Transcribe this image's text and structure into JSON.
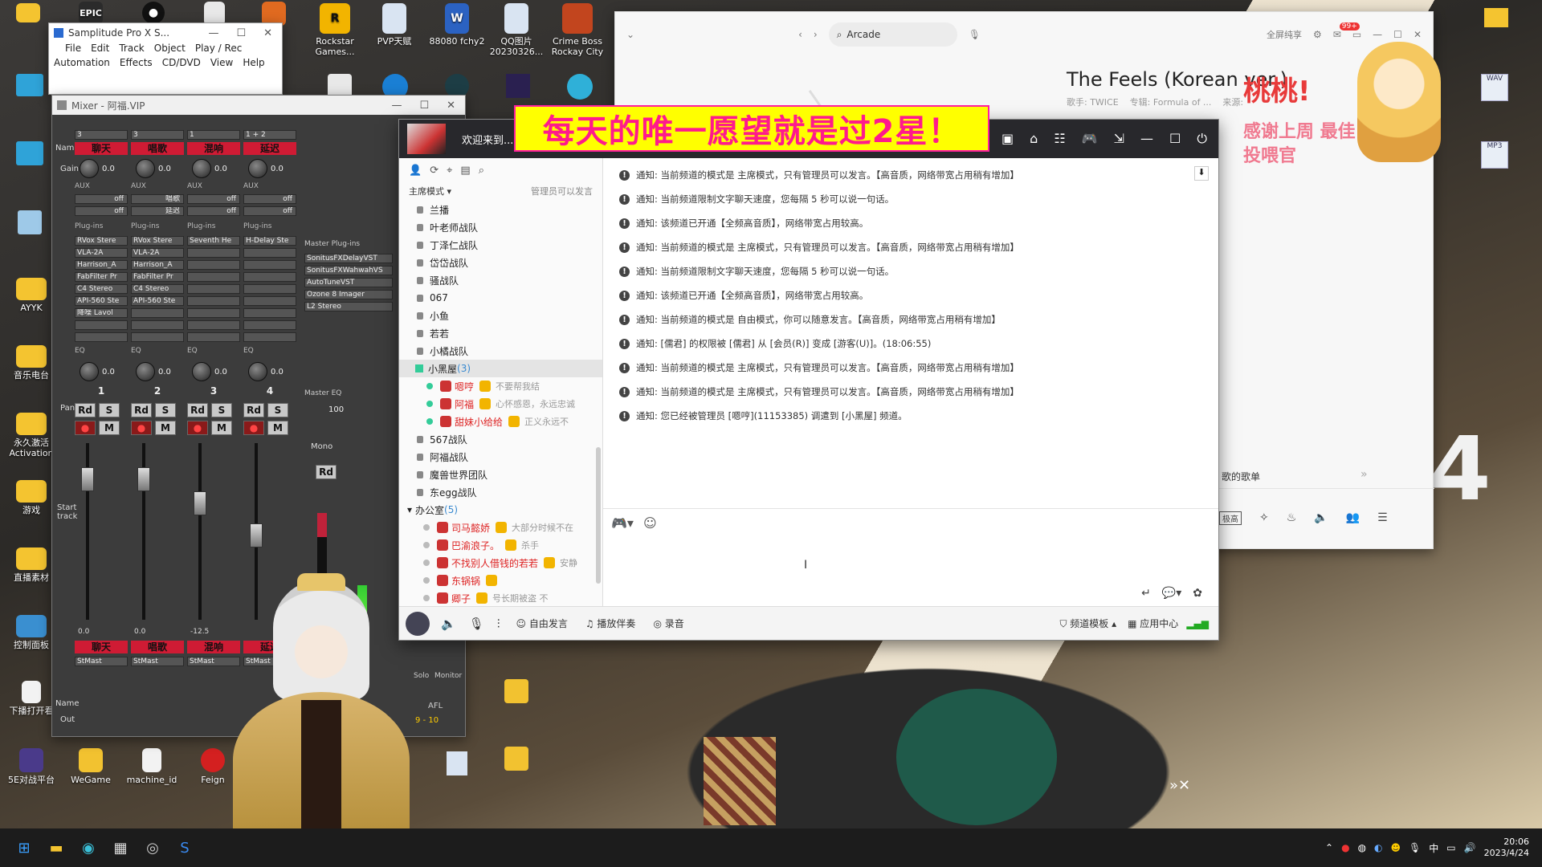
{
  "colors": {
    "accent_pink": "#ff1a8c",
    "banner_yellow": "#ffff00",
    "channel_red": "#cf1b34",
    "taskbar": "#1c1c1c"
  },
  "desktop": {
    "icons": [
      {
        "label": "EPIC",
        "icon": "epic-icon",
        "color": "#2b2b2b"
      },
      {
        "label": "",
        "icon": "qq-icon",
        "color": "#111"
      },
      {
        "label": "",
        "icon": "document-icon",
        "color": "#e8e8e8"
      },
      {
        "label": "",
        "icon": "app-icon",
        "color": "#e06a20"
      },
      {
        "label": "Rockstar Games...",
        "icon": "rockstar-icon",
        "color": "#f2b400"
      },
      {
        "label": "PVP天赋",
        "icon": "image-file-icon",
        "color": "#d9e4f2"
      },
      {
        "label": "88080 fchy2",
        "icon": "word-file-icon",
        "color": "#2b62c2"
      },
      {
        "label": "QQ图片 20230326...",
        "icon": "image-file-icon",
        "color": "#d9e4f2"
      },
      {
        "label": "Crime Boss Rockay City",
        "icon": "crime-boss-icon",
        "color": "#c2451e"
      }
    ],
    "left_icons": [
      {
        "label": "AYYK",
        "icon": "folder-icon"
      },
      {
        "label": "音乐电台",
        "icon": "folder-icon"
      },
      {
        "label": "永久激活 Activation",
        "icon": "folder-icon"
      },
      {
        "label": "游戏",
        "icon": "folder-icon"
      },
      {
        "label": "直播素材",
        "icon": "folder-icon"
      },
      {
        "label": "控制面板",
        "icon": "control-panel-icon"
      },
      {
        "label": "下播打开看",
        "icon": "text-file-icon"
      }
    ],
    "bottom_icons": [
      {
        "label": "5E对战平台",
        "icon": "5e-icon"
      },
      {
        "label": "WeGame",
        "icon": "wegame-icon"
      },
      {
        "label": "machine_id",
        "icon": "file-icon"
      },
      {
        "label": "Feign",
        "icon": "feign-icon"
      }
    ],
    "right_icons": [
      {
        "label": "WAV"
      },
      {
        "label": "MP3"
      }
    ],
    "big_digit": "4",
    "sticker_text": "桃桃!",
    "sticker_sub": "感谢上周 最佳投喂官"
  },
  "samplitude": {
    "title": "Samplitude Pro X S...",
    "menu1": [
      "File",
      "Edit",
      "Track",
      "Object",
      "Play / Rec"
    ],
    "menu2": [
      "Automation",
      "Effects",
      "CD/DVD",
      "View",
      "Help"
    ]
  },
  "mixer": {
    "title": "Mixer - 阿福.VIP",
    "labels": {
      "name": "Name",
      "gain": "Gain",
      "aux": "AUX",
      "plugins": "Plug-ins",
      "master_plugins": "Master Plug-ins",
      "eq": "EQ",
      "master_eq": "Master EQ",
      "pan": "Pan",
      "start_track": "Start track",
      "out": "Out",
      "mono": "Mono",
      "afl": "AFL",
      "solo": "Solo",
      "monitor": "Monitor"
    },
    "channels": [
      {
        "num": "1",
        "name": "聊天",
        "gain": "0.0",
        "in": "3",
        "plugins": [
          "RVox Stere",
          "VLA-2A",
          "Harrison_A",
          "FabFilter Pr",
          "C4 Stereo",
          "API-560 Ste",
          "降噪 Lavol"
        ],
        "eq": "0.0",
        "fader": "0.0",
        "out": "StMast"
      },
      {
        "num": "2",
        "name": "唱歌",
        "gain": "0.0",
        "in": "3",
        "plugins": [
          "RVox Stere",
          "VLA-2A",
          "Harrison_A",
          "FabFilter Pr",
          "C4 Stereo",
          "API-560 Ste"
        ],
        "eq": "0.0",
        "fader": "0.0",
        "out": "StMast"
      },
      {
        "num": "3",
        "name": "混响",
        "gain": "0.0",
        "in": "1",
        "plugins": [
          "Seventh He"
        ],
        "eq": "0.0",
        "fader": "-12.5",
        "out": "StMast"
      },
      {
        "num": "4",
        "name": "延迟",
        "gain": "0.0",
        "in": "1 + 2",
        "plugins": [
          "H-Delay Ste"
        ],
        "eq": "0.0",
        "fader": "",
        "out": "StMast"
      }
    ],
    "aux_slots": [
      [
        "off",
        "off"
      ],
      [
        "唱歌",
        "延迟"
      ],
      [
        "off",
        "off"
      ],
      [
        "off",
        "off"
      ]
    ],
    "aux_values": [
      "0.0",
      "0.0"
    ],
    "master_plugins": [
      "SonitusFXDelayVST",
      "SonitusFXWahwahVS",
      "AutoTuneVST",
      "Ozone 8 Imager",
      "L2 Stereo"
    ],
    "master_pan": "100",
    "master_out": "9 - 10",
    "btn_rd": "Rd",
    "btn_s": "S",
    "btn_m": "M"
  },
  "music": {
    "search": "Arcade",
    "topright": "全屏纯享",
    "badge": "99+",
    "song_title": "The Feels (Korean ver.)",
    "song_meta": "歌手: TWICE    专辑: Formula of ...    来源:",
    "playlist_label": "歌的歌单",
    "bottom_btn": "极高"
  },
  "yy": {
    "welcome": "欢迎来到...",
    "mode": "主席模式",
    "mode_note": "管理员可以发言",
    "channels": [
      {
        "name": "兰播",
        "type": "locked"
      },
      {
        "name": "叶老师战队",
        "type": "locked"
      },
      {
        "name": "丁泽仁战队",
        "type": "locked"
      },
      {
        "name": "岱岱战队",
        "type": "locked"
      },
      {
        "name": "骚战队",
        "type": "locked"
      },
      {
        "name": "067",
        "type": "locked"
      },
      {
        "name": "小鱼",
        "type": "locked"
      },
      {
        "name": "若若",
        "type": "locked"
      },
      {
        "name": "小橘战队",
        "type": "locked"
      }
    ],
    "current_channel": "小黑屋",
    "current_count": "(3)",
    "members": [
      {
        "name": "嗯哼",
        "note": "不要帮我结"
      },
      {
        "name": "阿福",
        "note": "心怀感恩，永远忠诚"
      },
      {
        "name": "甜妹小给给",
        "note": "正义永远不"
      }
    ],
    "channels2": [
      {
        "name": "567战队"
      },
      {
        "name": "阿福战队"
      },
      {
        "name": "魔兽世界团队"
      },
      {
        "name": "东egg战队"
      }
    ],
    "office": "办公室",
    "office_count": "(5)",
    "office_members": [
      {
        "name": "司马懿娇",
        "note": "大部分时候不在"
      },
      {
        "name": "巴渝浪子。",
        "note": "杀手"
      },
      {
        "name": "不找别人借钱的若若",
        "note": "安静"
      },
      {
        "name": "东锅锅",
        "note": ""
      },
      {
        "name": "卿子",
        "note": "号长期被盗 不"
      }
    ],
    "messages": [
      "通知: 当前频道的模式是 主席模式，只有管理员可以发言。【高音质，网络带宽占用稍有增加】",
      "通知: 当前频道限制文字聊天速度，您每隔 5 秒可以说一句话。",
      "通知: 该频道已开通【全频高音质】，网络带宽占用较高。",
      "通知: 当前频道的模式是 主席模式，只有管理员可以发言。【高音质，网络带宽占用稍有增加】",
      "通知: 当前频道限制文字聊天速度，您每隔 5 秒可以说一句话。",
      "通知: 该频道已开通【全频高音质】，网络带宽占用较高。",
      "通知: 当前频道的模式是 自由模式，你可以随意发言。【高音质，网络带宽占用稍有增加】",
      "通知: [儒君] 的权限被 [儒君] 从 [会员(R)] 变成 [游客(U)]。(18:06:55)",
      "通知: 当前频道的模式是 主席模式，只有管理员可以发言。【高音质，网络带宽占用稍有增加】",
      "通知: 当前频道的模式是 主席模式，只有管理员可以发言。【高音质，网络带宽占用稍有增加】",
      "通知: 您已经被管理员 [嗯哼](11153385) 调遣到 [小黑屋] 频道。"
    ],
    "footer": {
      "free_speak": "自由发言",
      "accompany": "播放伴奏",
      "record": "录音",
      "template": "频道模板",
      "apps": "应用中心"
    }
  },
  "banner": {
    "text": "每天的唯一愿望就是过2星！"
  },
  "taskbar": {
    "time": "20:06",
    "date": "2023/4/24",
    "ime": "中"
  }
}
